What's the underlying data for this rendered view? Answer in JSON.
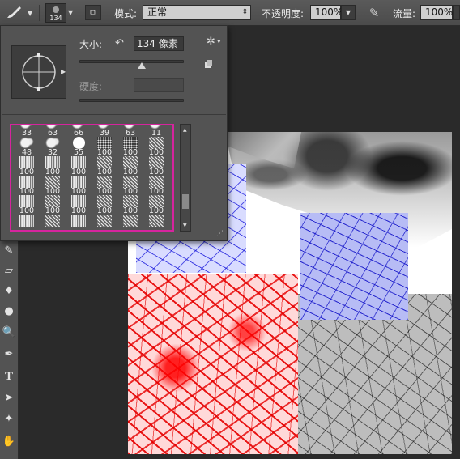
{
  "options_bar": {
    "brush_size": "134",
    "mode_label": "模式:",
    "mode_value": "正常",
    "opacity_label": "不透明度:",
    "opacity_value": "100%",
    "flow_label": "流量:",
    "flow_value": "100%"
  },
  "brush_panel": {
    "size_label": "大小:",
    "size_value": "134 像素",
    "hardness_label": "硬度:",
    "size_slider_fraction": 0.6,
    "hardness_slider_fraction": 0.0
  },
  "brush_presets": [
    {
      "label": "33",
      "kind": "blob"
    },
    {
      "label": "63",
      "kind": "blob"
    },
    {
      "label": "66",
      "kind": "blob"
    },
    {
      "label": "39",
      "kind": "blob"
    },
    {
      "label": "63",
      "kind": "blob"
    },
    {
      "label": "11",
      "kind": "blob"
    },
    {
      "label": "48",
      "kind": "blob"
    },
    {
      "label": "32",
      "kind": "blob"
    },
    {
      "label": "55",
      "kind": "round"
    },
    {
      "label": "100",
      "kind": "spray"
    },
    {
      "label": "100",
      "kind": "spray"
    },
    {
      "label": "100",
      "kind": "alt"
    },
    {
      "label": "100",
      "kind": "lines"
    },
    {
      "label": "100",
      "kind": "lines"
    },
    {
      "label": "100",
      "kind": "lines"
    },
    {
      "label": "100",
      "kind": "alt"
    },
    {
      "label": "100",
      "kind": "alt"
    },
    {
      "label": "100",
      "kind": "alt"
    },
    {
      "label": "100",
      "kind": "lines"
    },
    {
      "label": "100",
      "kind": "alt"
    },
    {
      "label": "100",
      "kind": "lines"
    },
    {
      "label": "100",
      "kind": "alt"
    },
    {
      "label": "100",
      "kind": "alt"
    },
    {
      "label": "100",
      "kind": "alt"
    },
    {
      "label": "100",
      "kind": "lines"
    },
    {
      "label": "100",
      "kind": "alt"
    },
    {
      "label": "100",
      "kind": "lines"
    },
    {
      "label": "100",
      "kind": "alt"
    },
    {
      "label": "100",
      "kind": "alt"
    },
    {
      "label": "100",
      "kind": "alt"
    },
    {
      "label": "",
      "kind": "lines"
    },
    {
      "label": "",
      "kind": "alt"
    },
    {
      "label": "",
      "kind": "lines"
    },
    {
      "label": "",
      "kind": "alt"
    },
    {
      "label": "",
      "kind": "alt"
    },
    {
      "label": "",
      "kind": "alt"
    }
  ],
  "colors": {
    "panel_bg": "#535353",
    "highlight_border": "#d6249e",
    "canvas_bg": "#2a2a2a"
  },
  "icons": {
    "brush_tool": "brush-icon",
    "toggle_panel": "brush-panel-toggle-icon",
    "airbrush": "airbrush-icon",
    "reset": "reset-icon",
    "settings": "gear-icon",
    "new_preset": "new-preset-icon"
  }
}
